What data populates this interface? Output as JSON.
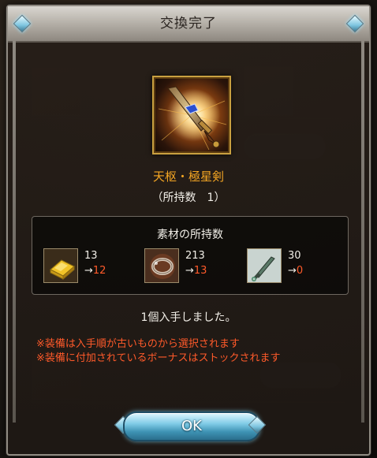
{
  "dialog": {
    "title": "交換完了"
  },
  "item": {
    "name": "天枢・極星剣",
    "owned_text": "（所持数　1）",
    "icon": "sword-icon"
  },
  "materials": {
    "header": "素材の所持数",
    "list": [
      {
        "icon": "gold-ingot-icon",
        "before": "13",
        "arrow": "→",
        "after": "12"
      },
      {
        "icon": "ring-material-icon",
        "before": "213",
        "arrow": "→",
        "after": "13"
      },
      {
        "icon": "weapon-material-icon",
        "before": "30",
        "arrow": "→",
        "after": "0"
      }
    ]
  },
  "result_text": "1個入手しました。",
  "notes": [
    "※装備は入手順が古いものから選択されます",
    "※装備に付加されているボーナスはストックされます"
  ],
  "ok_button": {
    "label": "OK"
  },
  "colors": {
    "item_name": "#f5a623",
    "note_text": "#ff5a2a",
    "after_value": "#ff5a2a"
  }
}
